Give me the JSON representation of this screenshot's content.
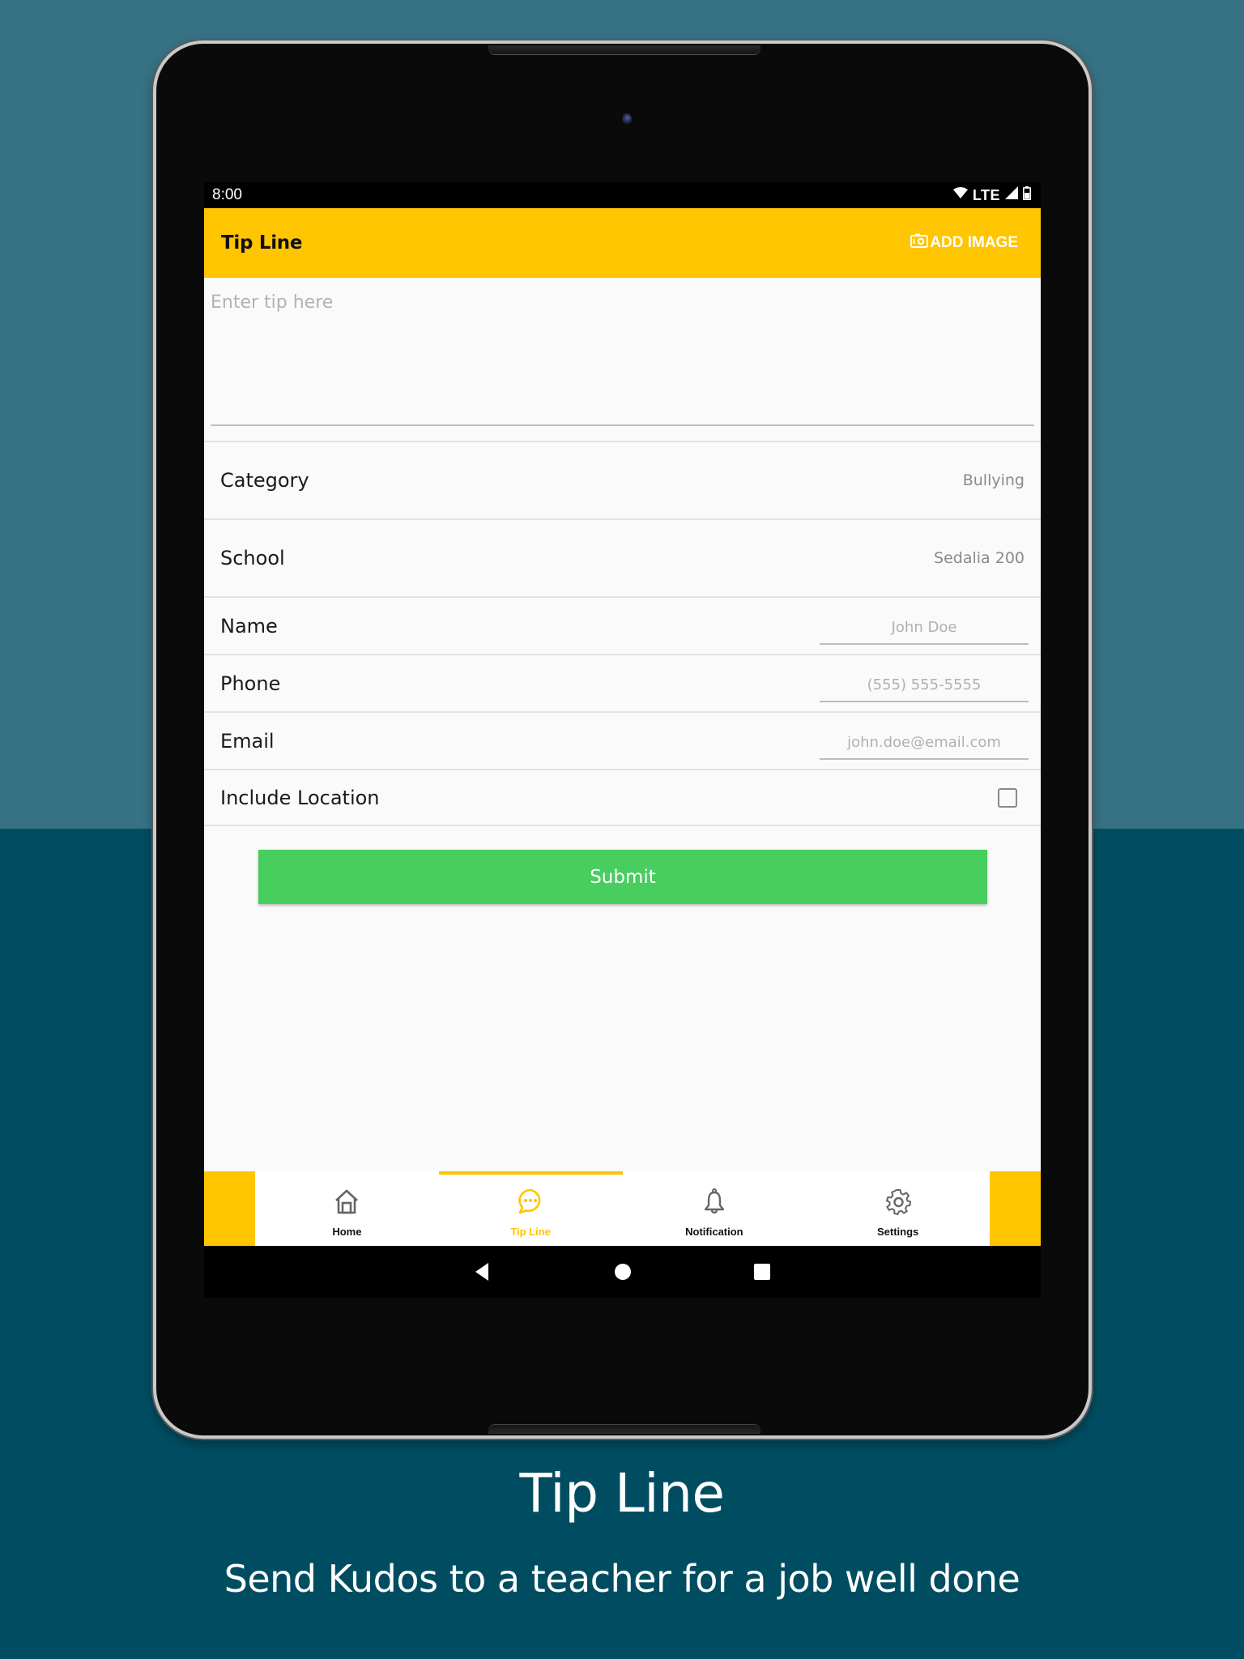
{
  "status_bar": {
    "time": "8:00",
    "network": "LTE",
    "icons": [
      "wifi-icon",
      "signal-icon",
      "battery-icon"
    ]
  },
  "app_bar": {
    "title": "Tip Line",
    "add_image_label": "ADD IMAGE",
    "add_image_icon": "camera-icon"
  },
  "tip_input": {
    "placeholder": "Enter tip here",
    "value": ""
  },
  "form": {
    "category": {
      "label": "Category",
      "value": "Bullying"
    },
    "school": {
      "label": "School",
      "value": "Sedalia 200"
    },
    "name": {
      "label": "Name",
      "placeholder": "John Doe",
      "value": ""
    },
    "phone": {
      "label": "Phone",
      "placeholder": "(555) 555-5555",
      "value": ""
    },
    "email": {
      "label": "Email",
      "placeholder": "john.doe@email.com",
      "value": ""
    },
    "include_location": {
      "label": "Include Location",
      "checked": false
    }
  },
  "submit_label": "Submit",
  "colors": {
    "accent": "#ffc500",
    "submit": "#48cd5f",
    "background_top": "#367284",
    "background_bottom": "#004d61"
  },
  "bottom_nav": {
    "items": [
      {
        "label": "Home",
        "icon": "home-icon",
        "active": false
      },
      {
        "label": "Tip Line",
        "icon": "chat-bubble-icon",
        "active": true
      },
      {
        "label": "Notification",
        "icon": "bell-icon",
        "active": false
      },
      {
        "label": "Settings",
        "icon": "gear-icon",
        "active": false
      }
    ]
  },
  "system_nav": [
    "back",
    "home",
    "recents"
  ],
  "caption": {
    "title": "Tip Line",
    "subtitle": "Send Kudos to a teacher for a job well done"
  }
}
